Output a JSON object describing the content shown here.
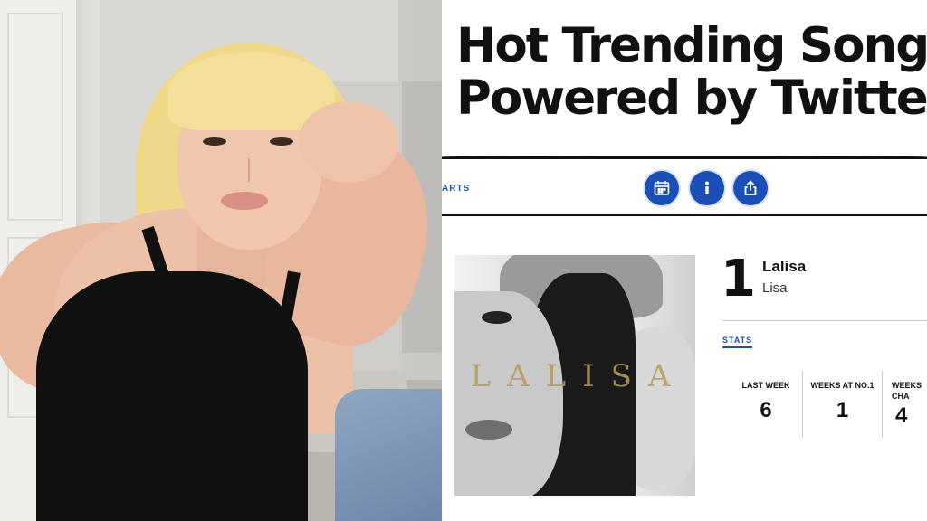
{
  "chart_page": {
    "headline_line1": "Hot Trending Song",
    "headline_line2": "Powered by Twitte",
    "toolbar_label": "ARTS",
    "icons": [
      "calendar-icon",
      "info-icon",
      "share-icon"
    ],
    "accent_color": "#1b4fb8",
    "album_word": "LALISA",
    "entry": {
      "rank": "1",
      "title": "Lalisa",
      "artist": "Lisa"
    },
    "stats_label": "STATS",
    "stats": [
      {
        "label": "LAST WEEK",
        "value": "6"
      },
      {
        "label": "WEEKS AT NO.1",
        "value": "1"
      },
      {
        "label": "WEEKS",
        "label2": "CHA",
        "value": "4"
      }
    ]
  }
}
